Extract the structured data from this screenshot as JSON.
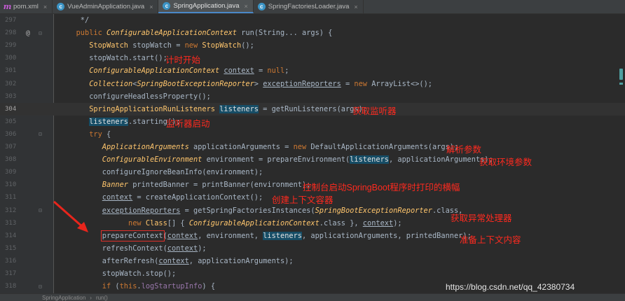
{
  "tabs": [
    {
      "icon": "m",
      "label": "pom.xml",
      "active": false
    },
    {
      "icon": "c",
      "label": "VueAdminApplication.java",
      "active": false
    },
    {
      "icon": "c",
      "label": "SpringApplication.java",
      "active": true
    },
    {
      "icon": "c",
      "label": "SpringFactoriesLoader.java",
      "active": false
    }
  ],
  "close_glyph": "×",
  "lines": [
    {
      "num": "297",
      "mark": "",
      "fold": "",
      "code": "    */"
    },
    {
      "num": "298",
      "mark": "@",
      "fold": "⊟",
      "code": "   public ConfigurableApplicationContext run(String... args) {"
    },
    {
      "num": "299",
      "mark": "",
      "fold": "",
      "code": "      StopWatch stopWatch = new StopWatch();"
    },
    {
      "num": "300",
      "mark": "",
      "fold": "",
      "code": "      stopWatch.start();"
    },
    {
      "num": "301",
      "mark": "",
      "fold": "",
      "code": "      ConfigurableApplicationContext context = null;"
    },
    {
      "num": "302",
      "mark": "",
      "fold": "",
      "code": "      Collection<SpringBootExceptionReporter> exceptionReporters = new ArrayList<>();"
    },
    {
      "num": "303",
      "mark": "",
      "fold": "",
      "code": "      configureHeadlessProperty();"
    },
    {
      "num": "304",
      "mark": "",
      "fold": "",
      "code": "      SpringApplicationRunListeners listeners = getRunListeners(args);"
    },
    {
      "num": "305",
      "mark": "",
      "fold": "",
      "code": "      listeners.starting();"
    },
    {
      "num": "306",
      "mark": "",
      "fold": "⊟",
      "code": "      try {"
    },
    {
      "num": "307",
      "mark": "",
      "fold": "",
      "code": "         ApplicationArguments applicationArguments = new DefaultApplicationArguments(args);"
    },
    {
      "num": "308",
      "mark": "",
      "fold": "",
      "code": "         ConfigurableEnvironment environment = prepareEnvironment(listeners, applicationArguments);"
    },
    {
      "num": "309",
      "mark": "",
      "fold": "",
      "code": "         configureIgnoreBeanInfo(environment);"
    },
    {
      "num": "310",
      "mark": "",
      "fold": "",
      "code": "         Banner printedBanner = printBanner(environment);"
    },
    {
      "num": "311",
      "mark": "",
      "fold": "",
      "code": "         context = createApplicationContext();"
    },
    {
      "num": "312",
      "mark": "",
      "fold": "⊟",
      "code": "         exceptionReporters = getSpringFactoriesInstances(SpringBootExceptionReporter.class,"
    },
    {
      "num": "313",
      "mark": "",
      "fold": "",
      "code": "               new Class[] { ConfigurableApplicationContext.class }, context);"
    },
    {
      "num": "314",
      "mark": "",
      "fold": "",
      "code": "         prepareContext(context, environment, listeners, applicationArguments, printedBanner);"
    },
    {
      "num": "315",
      "mark": "",
      "fold": "",
      "code": "         refreshContext(context);"
    },
    {
      "num": "316",
      "mark": "",
      "fold": "",
      "code": "         afterRefresh(context, applicationArguments);"
    },
    {
      "num": "317",
      "mark": "",
      "fold": "",
      "code": "         stopWatch.stop();"
    },
    {
      "num": "318",
      "mark": "",
      "fold": "⊟",
      "code": "         if (this.logStartupInfo) {"
    }
  ],
  "notes": {
    "n300": "计时开始",
    "n304": "获取监听器",
    "n305": "监听器启动",
    "n307": "解析参数",
    "n308": "获取环境参数",
    "n310": "控制台启动SpringBoot程序时打印的横幅",
    "n311": "创建上下文容器",
    "n312": "获取异常处理器",
    "n314": "准备上下文内容"
  },
  "breadcrumb": [
    "SpringApplication",
    "run()"
  ],
  "breadcrumb_sep": "›",
  "watermark": "https://blog.csdn.net/qq_42380734",
  "colors": {
    "annotation": "#ff2a1f",
    "background": "#2b2b2b",
    "keyword": "#cc7832",
    "highlight": "#164d66"
  }
}
